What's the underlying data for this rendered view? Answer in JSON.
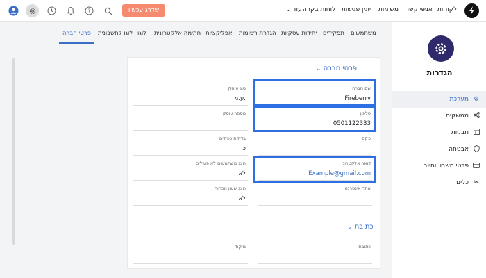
{
  "topbar": {
    "nav": [
      "לקוחות",
      "אנשי קשר",
      "משימות",
      "יומן פגישות",
      "לוחות בקרה",
      "עוד"
    ],
    "upgrade_label": "שדרג עכשיו"
  },
  "sidebar": {
    "title": "הגדרות",
    "items": [
      {
        "label": "מערכת",
        "icon": "gear-icon"
      },
      {
        "label": "ממשקים",
        "icon": "share-icon"
      },
      {
        "label": "תבניות",
        "icon": "template-icon"
      },
      {
        "label": "אבטחה",
        "icon": "shield-icon"
      },
      {
        "label": "פרטי חשבון וחיוב",
        "icon": "billing-icon"
      },
      {
        "label": "כלים",
        "icon": "tools-icon"
      }
    ]
  },
  "tabs": [
    "פרטי חברה",
    "לוגו לחשבונית",
    "לוגו",
    "חתימה אלקטרונית",
    "אפליקציות",
    "הגדרת רשומות",
    "יחידות עסקיות",
    "תפקידים",
    "משתמשים"
  ],
  "company_section": {
    "title": "פרטי חברה",
    "fields": {
      "company_name": {
        "label": "שם חברה",
        "value": "Fireberry"
      },
      "business_type": {
        "label": "סוג עוסק",
        "value": "ע.מ."
      },
      "phone": {
        "label": "טלפון",
        "value": "0501122333"
      },
      "business_number": {
        "label": "מספר עוסק",
        "value": ""
      },
      "fax": {
        "label": "פקס",
        "value": ""
      },
      "duplicate_check": {
        "label": "בדיקת כפילים",
        "value": "כן"
      },
      "email": {
        "label": "דואר אלקטרוני",
        "value": "Example@gmail.com"
      },
      "show_inactive_users": {
        "label": "הצג משתמשים לא פעילים",
        "value": "לא"
      },
      "website": {
        "label": "אתר אינטרנט",
        "value": ""
      },
      "show_current_time": {
        "label": "הצג שעון נוכחות",
        "value": "לא"
      }
    }
  },
  "address_section": {
    "title": "כתובת",
    "fields": {
      "address": {
        "label": "כתובת",
        "value": ""
      },
      "zip": {
        "label": "מיקוד",
        "value": ""
      }
    }
  },
  "colors": {
    "accent": "#3b6ec7",
    "upgrade": "#f58a6e",
    "highlight": "#2f6fe4",
    "logo": "#2f2a6b"
  }
}
